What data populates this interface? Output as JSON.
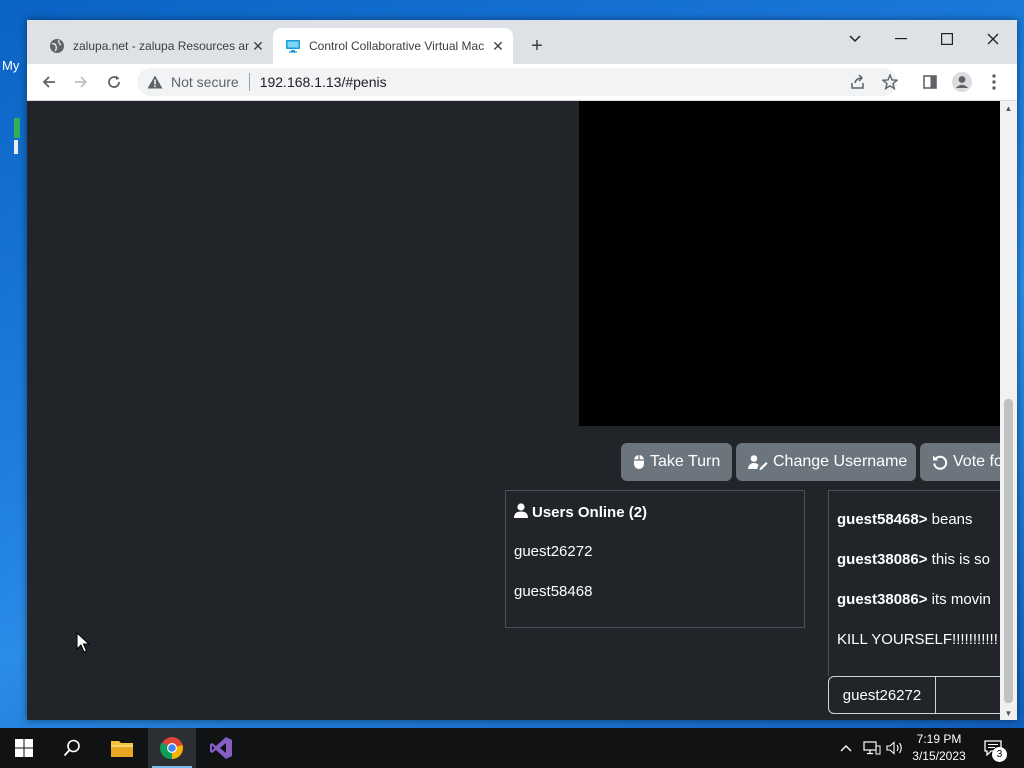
{
  "desktop": {
    "partial_text": "My"
  },
  "browser": {
    "tabs": [
      {
        "title": "zalupa.net - zalupa Resources and",
        "active": false
      },
      {
        "title": "Control Collaborative Virtual Mac",
        "active": true
      }
    ],
    "address": {
      "security_label": "Not secure",
      "url": "192.168.1.13/#penis"
    }
  },
  "page": {
    "buttons": {
      "take_turn": "Take Turn",
      "change_username": "Change Username",
      "vote": "Vote fo"
    },
    "users": {
      "header": "Users Online (2)",
      "list": [
        "guest26272",
        "guest58468"
      ]
    },
    "chat": {
      "messages": [
        {
          "user": "guest58468>",
          "text": " beans"
        },
        {
          "user": "guest38086>",
          "text": " this is so"
        },
        {
          "user": "guest38086>",
          "text": " its movin"
        },
        {
          "user": "",
          "text": "KILL YOURSELF!!!!!!!!!!!"
        }
      ],
      "username": "guest26272"
    }
  },
  "taskbar": {
    "time": "7:19 PM",
    "date": "3/15/2023",
    "notification_count": "3"
  },
  "colors": {
    "page_bg": "#212529",
    "button_bg": "#6c757d",
    "vm_screen": "#000000"
  }
}
